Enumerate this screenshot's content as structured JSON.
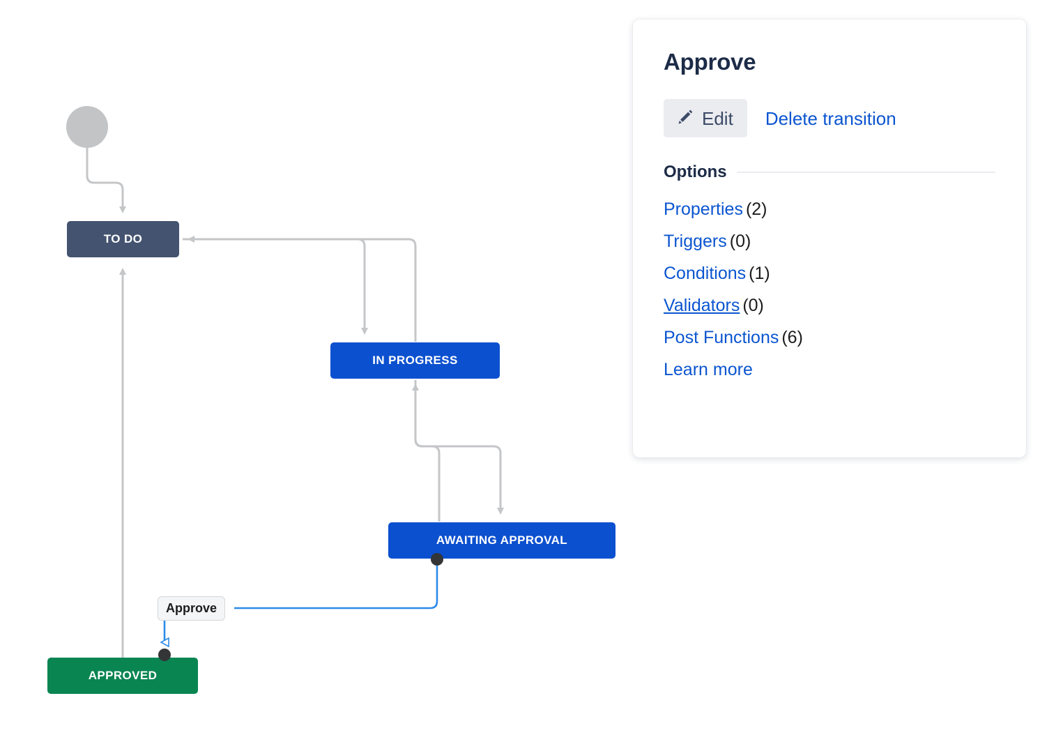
{
  "workflow": {
    "start_node": {
      "name": "start-circle"
    },
    "nodes": [
      {
        "id": "todo",
        "label": "TO DO",
        "color": "#435370",
        "style": "slate"
      },
      {
        "id": "inprog",
        "label": "IN PROGRESS",
        "color": "#0B50CF",
        "style": "blue"
      },
      {
        "id": "awaiting",
        "label": "AWAITING APPROVAL",
        "color": "#0B50CF",
        "style": "blue"
      },
      {
        "id": "approved",
        "label": "APPROVED",
        "color": "#098551",
        "style": "green"
      }
    ],
    "selected_transition_label": "Approve",
    "edge_color": "#C4C6C8",
    "selected_edge_color": "#2D8AE8"
  },
  "panel": {
    "title": "Approve",
    "edit_label": "Edit",
    "edit_icon": "pencil-icon",
    "delete_label": "Delete transition",
    "options_title": "Options",
    "options": [
      {
        "label": "Properties",
        "count": "(2)",
        "underlined": false
      },
      {
        "label": "Triggers",
        "count": "(0)",
        "underlined": false
      },
      {
        "label": "Conditions",
        "count": "(1)",
        "underlined": false
      },
      {
        "label": "Validators",
        "count": "(0)",
        "underlined": true
      },
      {
        "label": "Post Functions",
        "count": "(6)",
        "underlined": false
      },
      {
        "label": "Learn more",
        "count": "",
        "underlined": false
      }
    ]
  },
  "colors": {
    "link_blue": "#0B55D0",
    "heading": "#1c2b47",
    "button_bg": "#EBECF0"
  }
}
